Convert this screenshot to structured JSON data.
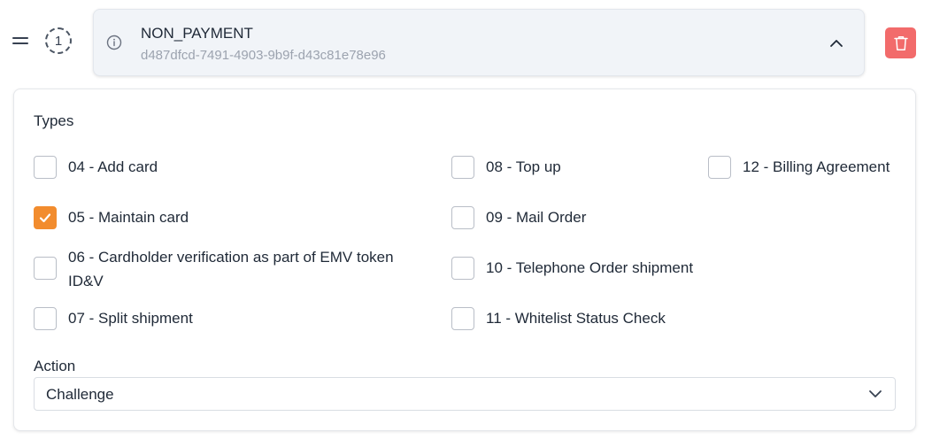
{
  "step": {
    "number": "1"
  },
  "header": {
    "title": "NON_PAYMENT",
    "subtitle": "d487dfcd-7491-4903-9b9f-d43c81e78e96"
  },
  "types": {
    "label": "Types",
    "options": [
      {
        "label": "04 - Add card",
        "checked": false
      },
      {
        "label": "05 - Maintain card",
        "checked": true
      },
      {
        "label": "06 - Cardholder verification as part of EMV token ID&V",
        "checked": false
      },
      {
        "label": "07 - Split shipment",
        "checked": false
      },
      {
        "label": "08 - Top up",
        "checked": false
      },
      {
        "label": "09 - Mail Order",
        "checked": false
      },
      {
        "label": "10 - Telephone Order shipment",
        "checked": false
      },
      {
        "label": "11 - Whitelist Status Check",
        "checked": false
      },
      {
        "label": "12 - Billing Agreement",
        "checked": false
      }
    ]
  },
  "action": {
    "label": "Action",
    "selected": "Challenge"
  },
  "colors": {
    "accent": "#f28c2e",
    "danger": "#f26b6b"
  },
  "icons": {
    "drag": "drag-handle-icon",
    "info": "info-icon",
    "collapse": "chevron-up-icon",
    "delete": "trash-icon",
    "check": "check-icon",
    "dropdown": "chevron-down-icon"
  }
}
